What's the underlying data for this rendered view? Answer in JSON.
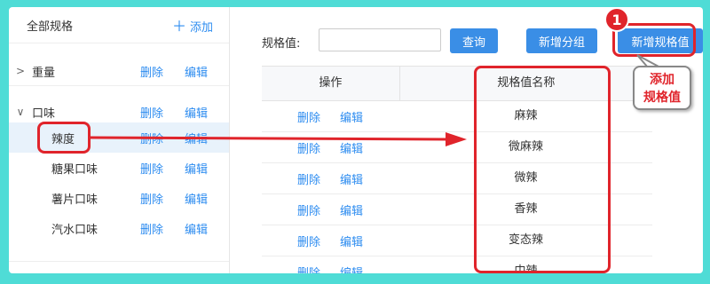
{
  "sidebar": {
    "header": {
      "title": "全部规格",
      "add_label": "添加"
    },
    "rows": [
      {
        "name": "重量",
        "expanded": false,
        "delete": "删除",
        "edit": "编辑"
      },
      {
        "name": "口味",
        "expanded": true,
        "delete": "删除",
        "edit": "编辑"
      },
      {
        "name": "辣度",
        "delete": "删除",
        "edit": "编辑"
      },
      {
        "name": "糖果口味",
        "delete": "删除",
        "edit": "编辑"
      },
      {
        "name": "薯片口味",
        "delete": "删除",
        "edit": "编辑"
      },
      {
        "name": "汽水口味",
        "delete": "删除",
        "edit": "编辑"
      }
    ]
  },
  "toolbar": {
    "label": "规格值:",
    "input_value": "",
    "query_button": "查询",
    "new_group_button": "新增分组",
    "new_value_button": "新增规格值"
  },
  "table": {
    "headers": {
      "ops": "操作",
      "name": "规格值名称"
    },
    "rows": [
      {
        "name": "麻辣",
        "delete": "删除",
        "edit": "编辑"
      },
      {
        "name": "微麻辣",
        "delete": "删除",
        "edit": "编辑"
      },
      {
        "name": "微辣",
        "delete": "删除",
        "edit": "编辑"
      },
      {
        "name": "香辣",
        "delete": "删除",
        "edit": "编辑"
      },
      {
        "name": "变态辣",
        "delete": "删除",
        "edit": "编辑"
      },
      {
        "name": "中辣",
        "delete": "删除",
        "edit": "编辑"
      }
    ]
  },
  "annotations": {
    "step_number": "1",
    "callout_line1": "添加",
    "callout_line2": "规格值"
  },
  "colors": {
    "accent": "#2d8cf0",
    "button": "#3a8ee6",
    "highlight": "#e0242b",
    "background": "#4fdcd6"
  }
}
